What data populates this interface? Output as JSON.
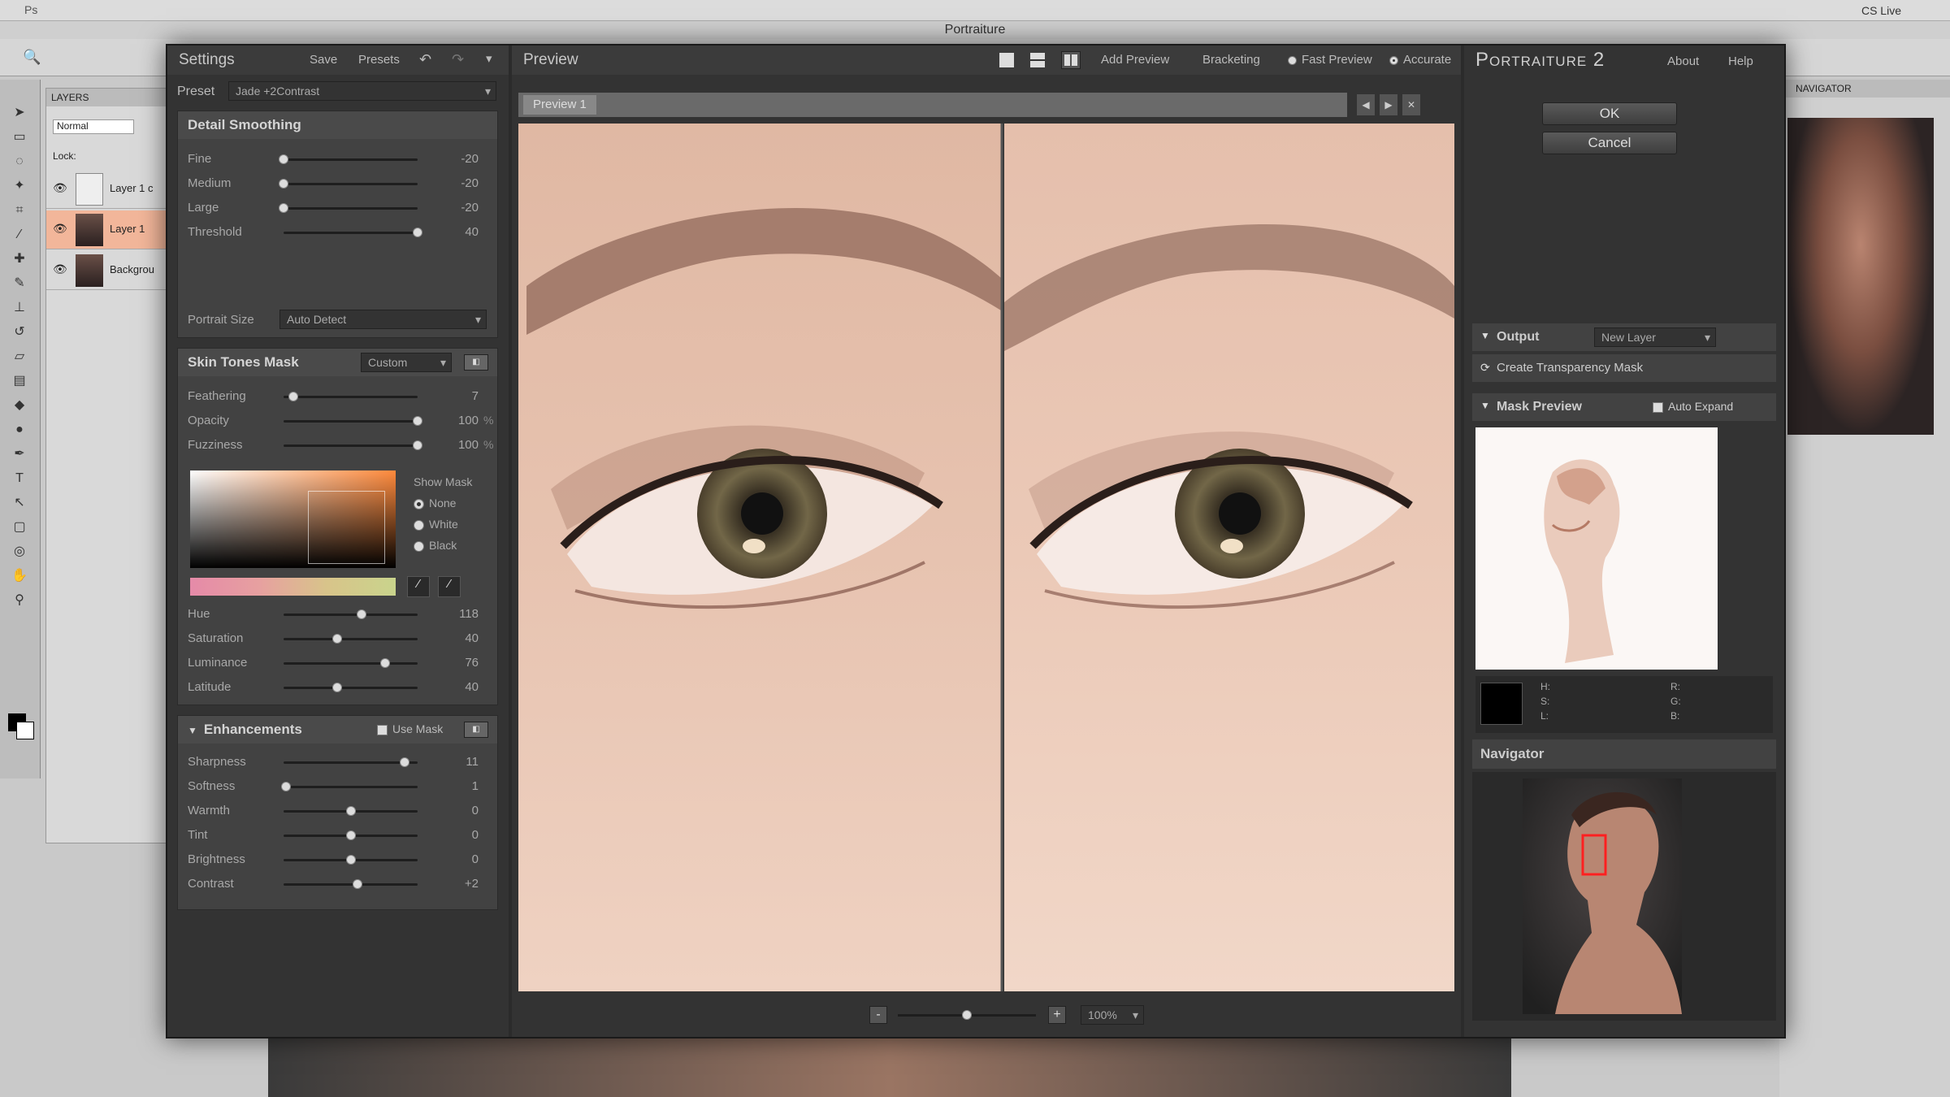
{
  "photoshop": {
    "title": "Portraiture",
    "layers_tab": "LAYERS",
    "blend_mode": "Normal",
    "lock_label": "Lock:",
    "layers": [
      "Layer 1 c",
      "Layer 1",
      "Backgrou"
    ],
    "panel_tab": "NAVIGATOR",
    "cs_live": "CS Live"
  },
  "settings": {
    "title": "Settings",
    "save": "Save",
    "presets": "Presets",
    "preset_label": "Preset",
    "preset_value": "Jade +2Contrast",
    "detail_smoothing": {
      "title": "Detail Smoothing",
      "sliders": [
        {
          "label": "Fine",
          "value": "-20",
          "pos": 0
        },
        {
          "label": "Medium",
          "value": "-20",
          "pos": 0
        },
        {
          "label": "Large",
          "value": "-20",
          "pos": 0
        },
        {
          "label": "Threshold",
          "value": "40",
          "pos": 1
        }
      ],
      "portrait_size_label": "Portrait Size",
      "portrait_size_value": "Auto Detect"
    },
    "skin_tones": {
      "title": "Skin Tones Mask",
      "mode": "Custom",
      "sliders": [
        {
          "label": "Feathering",
          "value": "7",
          "unit": "",
          "pos": 0.07
        },
        {
          "label": "Opacity",
          "value": "100",
          "unit": "%",
          "pos": 1
        },
        {
          "label": "Fuzziness",
          "value": "100",
          "unit": "%",
          "pos": 1
        }
      ],
      "show_mask_label": "Show Mask",
      "show_mask_options": [
        "None",
        "White",
        "Black"
      ],
      "color_sliders": [
        {
          "label": "Hue",
          "value": "118",
          "pos": 0.58
        },
        {
          "label": "Saturation",
          "value": "40",
          "pos": 0.4
        },
        {
          "label": "Luminance",
          "value": "76",
          "pos": 0.76
        },
        {
          "label": "Latitude",
          "value": "40",
          "pos": 0.4
        }
      ]
    },
    "enhancements": {
      "title": "Enhancements",
      "use_mask": "Use Mask",
      "sliders": [
        {
          "label": "Sharpness",
          "value": "11",
          "pos": 0.9
        },
        {
          "label": "Softness",
          "value": "1",
          "pos": 0.02
        },
        {
          "label": "Warmth",
          "value": "0",
          "pos": 0.5
        },
        {
          "label": "Tint",
          "value": "0",
          "pos": 0.5
        },
        {
          "label": "Brightness",
          "value": "0",
          "pos": 0.5
        },
        {
          "label": "Contrast",
          "value": "+2",
          "pos": 0.55
        }
      ]
    }
  },
  "preview": {
    "title": "Preview",
    "add_preview": "Add Preview",
    "bracketing": "Bracketing",
    "fast_preview": "Fast Preview",
    "accurate": "Accurate",
    "tab": "Preview 1",
    "zoom": "100%",
    "zoom_minus": "-",
    "zoom_plus": "+",
    "zoom_pos": 0.5
  },
  "right": {
    "brand": "Portraiture 2",
    "about": "About",
    "help": "Help",
    "ok": "OK",
    "cancel": "Cancel",
    "output_label": "Output",
    "output_value": "New Layer",
    "create_mask": "Create Transparency Mask",
    "mask_preview": "Mask Preview",
    "auto_expand": "Auto Expand",
    "readout_left": [
      "H:",
      "S:",
      "L:"
    ],
    "readout_right": [
      "R:",
      "G:",
      "B:"
    ],
    "navigator": "Navigator"
  }
}
